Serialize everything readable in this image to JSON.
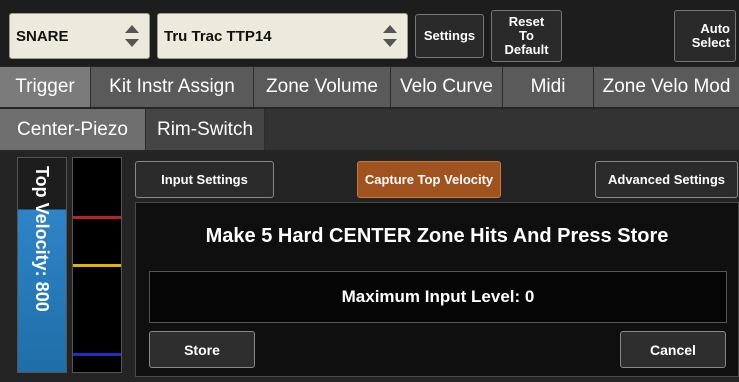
{
  "top_bar": {
    "kit_piece_select": "SNARE",
    "trigger_model_select": "Tru Trac TTP14",
    "settings_label": "Settings",
    "reset_label_line1": "Reset",
    "reset_label_line2": "To",
    "reset_label_line3": "Default",
    "auto_select_line1": "Auto",
    "auto_select_line2": "Select"
  },
  "main_tabs": [
    {
      "label": "Trigger",
      "active": true
    },
    {
      "label": "Kit Instr Assign",
      "active": false
    },
    {
      "label": "Zone Volume",
      "active": false
    },
    {
      "label": "Velo Curve",
      "active": false
    },
    {
      "label": "Midi",
      "active": false
    },
    {
      "label": "Zone Velo Mod",
      "active": false
    }
  ],
  "sub_tabs": [
    {
      "label": "Center-Piezo",
      "active": true
    },
    {
      "label": "Rim-Switch",
      "active": false
    }
  ],
  "velocity": {
    "label": "Top Velocity: 800",
    "colors": {
      "bar": "#2f84c7"
    }
  },
  "meter": {
    "colors": {
      "high": "#c0202a",
      "mid": "#e2b400",
      "low": "#1e2fc8"
    }
  },
  "panel_buttons": {
    "input_settings": "Input Settings",
    "capture_top_velocity": "Capture Top Velocity",
    "advanced_settings": "Advanced Settings"
  },
  "dialog": {
    "message": "Make 5 Hard CENTER Zone Hits And Press Store",
    "level_text": "Maximum Input Level: 0",
    "store_label": "Store",
    "cancel_label": "Cancel"
  },
  "colors": {
    "accent_capture": "#a0521f",
    "select_bg": "#eceadc"
  }
}
